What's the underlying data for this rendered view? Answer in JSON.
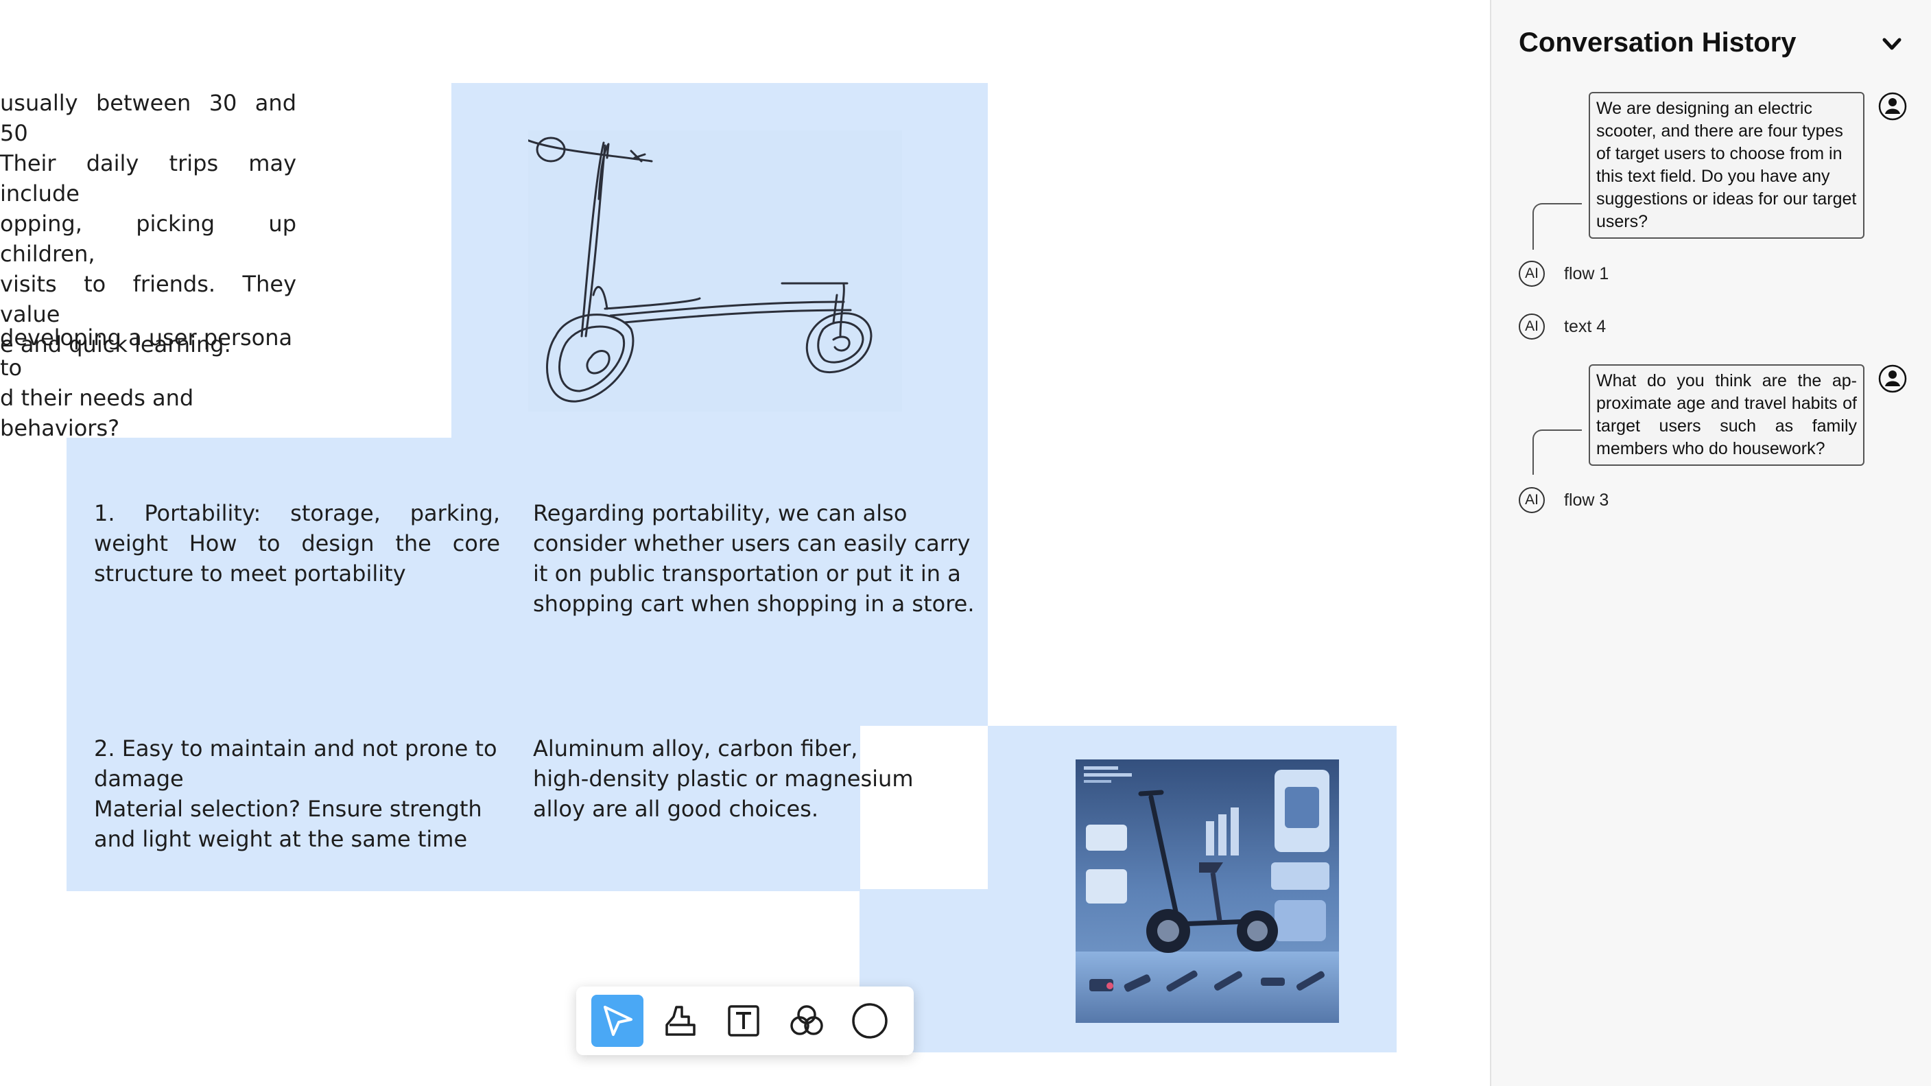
{
  "canvas": {
    "intro_lines": [
      "usually between 30 and 50",
      "Their daily trips may include",
      "opping, picking up children,",
      "visits to friends. They value",
      "e and quick learning."
    ],
    "persona_lines": [
      "developing a user persona to",
      "d their needs and behaviors?"
    ],
    "note1_left": "1. Portability: storage, parking, weight How to design the core structure to meet portability",
    "note1_right": "Regarding portability, we can also consider whether users can easily carry it on public transportation or put it in a shopping cart when shopping in a store.",
    "note2_left_line1": "2. Easy to maintain and not prone to damage",
    "note2_left_line2": "Material selection? Ensure strength and light weight at the same time",
    "note2_right": "Aluminum alloy, carbon fiber, high-density plastic or magnesium alloy are all good choices."
  },
  "toolbar": {
    "tools": [
      {
        "name": "select",
        "icon": "cursor-icon",
        "active": true
      },
      {
        "name": "sketch",
        "icon": "sketch-icon",
        "active": false
      },
      {
        "name": "text",
        "icon": "text-icon",
        "active": false
      },
      {
        "name": "combine",
        "icon": "circles-icon",
        "active": false
      },
      {
        "name": "shape",
        "icon": "circle-icon",
        "active": false
      }
    ]
  },
  "panel": {
    "title": "Conversation History",
    "messages": [
      {
        "role": "user",
        "text": "We are designing an electric scooter, and there are four types of target users to choose from in this text field. Do you have any suggestions or ideas for our target users?"
      },
      {
        "role": "ai",
        "badge": "AI",
        "label": "flow 1"
      },
      {
        "role": "ai",
        "badge": "AI",
        "label": "text 4"
      },
      {
        "role": "user",
        "text": "What do you think are the ap-proximate age and travel habits of target users such as family members who do housework?"
      },
      {
        "role": "ai",
        "badge": "AI",
        "label": "flow 3"
      }
    ]
  },
  "colors": {
    "note_blue": "#d6e7fc",
    "active_tool": "#4aa8f5",
    "panel_bg": "#f7f7f7"
  }
}
